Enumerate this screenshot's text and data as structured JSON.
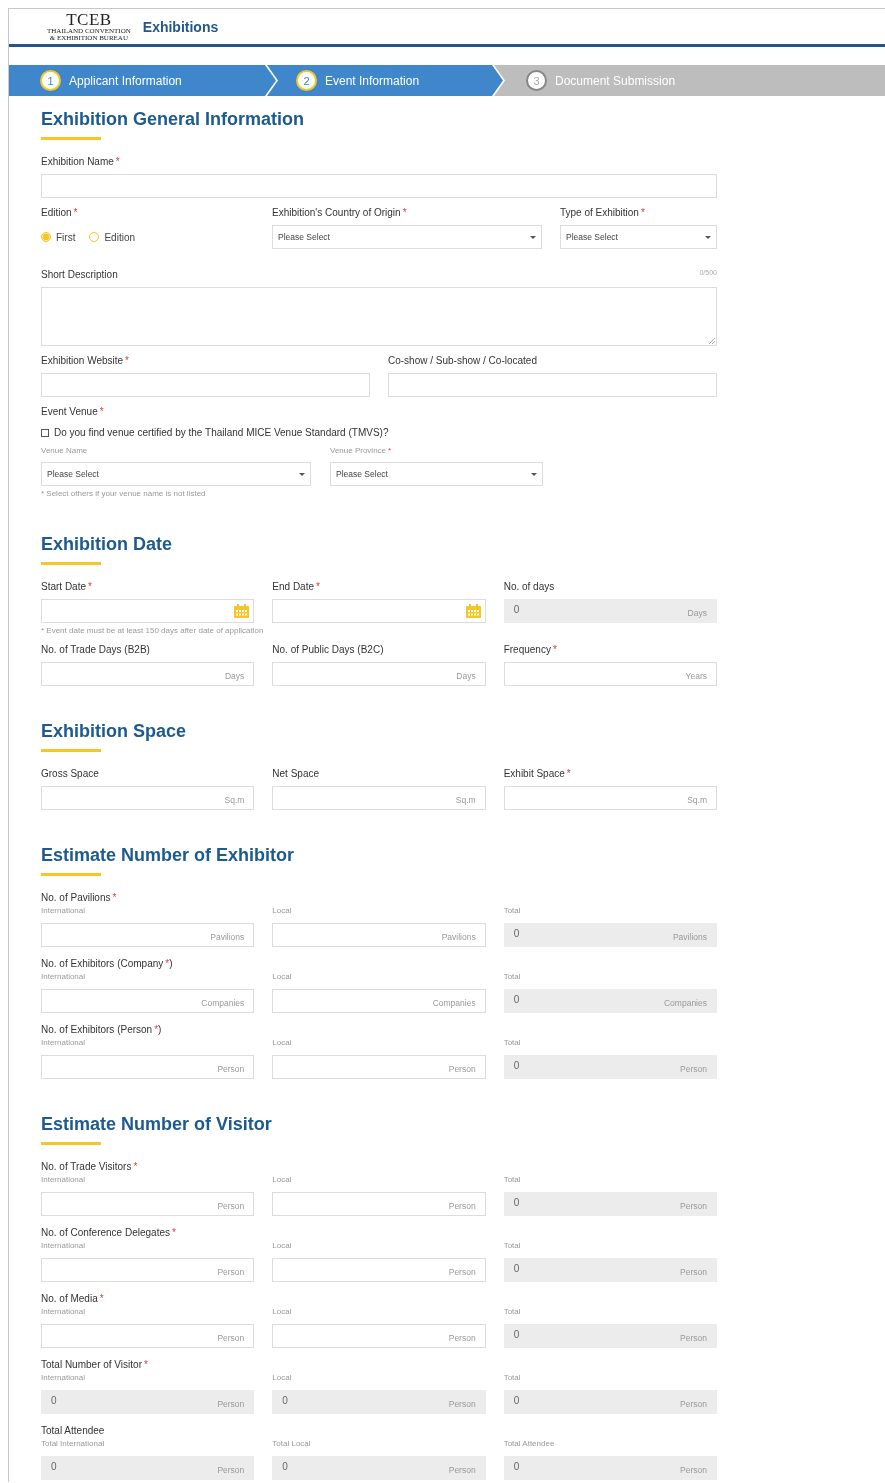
{
  "header": {
    "logo": {
      "wordmark": "TCEB",
      "line_1": "THAILAND CONVENTION",
      "line_2": "& EXHIBITION BUREAU"
    },
    "title": "Exhibitions"
  },
  "steps": [
    {
      "number": "1",
      "label": "Applicant Information",
      "active": true
    },
    {
      "number": "2",
      "label": "Event Information",
      "active": true
    },
    {
      "number": "3",
      "label": "Document Submission",
      "active": false
    }
  ],
  "sections": [
    {
      "title": "Exhibition General Information",
      "rows": [
        {
          "kind": "single",
          "fields": [
            {
              "kind": "text",
              "label": "Exhibition Name",
              "required_mark": "*"
            }
          ]
        },
        {
          "kind": "choice",
          "fields": [
            {
              "kind": "radio",
              "label": "Edition",
              "required_mark": "*",
              "options": [
                {
                  "label": "First",
                  "selected": true
                },
                {
                  "label": "Edition",
                  "selected": false
                }
              ]
            },
            {
              "kind": "select",
              "label": "Exhibition's Country of Origin",
              "required_mark": "*",
              "value": "Please Select"
            },
            {
              "kind": "select",
              "label": "Type of Exhibition",
              "required_mark": "*",
              "value": "Please Select"
            }
          ]
        },
        {
          "kind": "single",
          "fields": [
            {
              "kind": "textarea",
              "label": "Short Description",
              "counter": "0/500"
            }
          ]
        },
        {
          "kind": "pair",
          "fields": [
            {
              "kind": "text",
              "label": "Exhibition Website",
              "required_mark": "*"
            },
            {
              "kind": "text",
              "label": "Co-show / Sub-show / Co-located"
            }
          ]
        },
        {
          "kind": "venue",
          "label": "Event Venue",
          "required_mark": "*",
          "checkbox": {
            "label": "Do you find venue certified by the Thailand MICE Venue Standard (TMVS)?",
            "checked": false
          },
          "fields": [
            {
              "kind": "select",
              "sublabel": "Venue Name",
              "value": "Please Select"
            },
            {
              "kind": "select",
              "sublabel": "Venue Province",
              "required_mark": "*",
              "value": "Please Select"
            }
          ],
          "note": "* Select others if your venue name is not listed"
        }
      ]
    },
    {
      "title": "Exhibition Date",
      "rows": [
        {
          "kind": "triple",
          "fields": [
            {
              "kind": "date",
              "label": "Start Date",
              "required_mark": "*"
            },
            {
              "kind": "date",
              "label": "End Date",
              "required_mark": "*"
            },
            {
              "kind": "unit",
              "label": "No. of days",
              "readonly": true,
              "value": "0",
              "unit": "Days"
            }
          ]
        },
        {
          "kind": "note",
          "note": "* Event date must be at least 150 days after date of application"
        },
        {
          "kind": "triple",
          "fields": [
            {
              "kind": "unit",
              "label": "No. of Trade Days (B2B)",
              "unit": "Days",
              "readonly": false
            },
            {
              "kind": "unit",
              "label": "No. of Public Days (B2C)",
              "unit": "Days",
              "readonly": false
            },
            {
              "kind": "unit",
              "label": "Frequency",
              "required_mark": "*",
              "unit": "Years",
              "readonly": false
            }
          ]
        }
      ]
    },
    {
      "title": "Exhibition Space",
      "rows": [
        {
          "kind": "triple",
          "fields": [
            {
              "kind": "unit",
              "label": "Gross Space",
              "unit": "Sq.m",
              "readonly": false
            },
            {
              "kind": "unit",
              "label": "Net Space",
              "unit": "Sq.m",
              "readonly": false
            },
            {
              "kind": "unit",
              "label": "Exhibit Space",
              "required_mark": "*",
              "unit": "Sq.m",
              "readonly": false
            }
          ]
        }
      ]
    },
    {
      "title": "Estimate Number of Exhibitor",
      "rows": [
        {
          "kind": "group",
          "label": "No. of Pavilions",
          "required_mark": "*",
          "fields": [
            {
              "kind": "unit",
              "sublabel": "International",
              "unit": "Pavilions",
              "readonly": false
            },
            {
              "kind": "unit",
              "sublabel": "Local",
              "unit": "Pavilions",
              "readonly": false
            },
            {
              "kind": "unit",
              "sublabel": "Total",
              "unit": "Pavilions",
              "readonly": true,
              "value": "0"
            }
          ]
        },
        {
          "kind": "group",
          "label": "No. of Exhibitors (Company",
          "required_mark": "*",
          "label_end": ")",
          "fields": [
            {
              "kind": "unit",
              "sublabel": "International",
              "unit": "Companies",
              "readonly": false
            },
            {
              "kind": "unit",
              "sublabel": "Local",
              "unit": "Companies",
              "readonly": false
            },
            {
              "kind": "unit",
              "sublabel": "Total",
              "unit": "Companies",
              "readonly": true,
              "value": "0"
            }
          ]
        },
        {
          "kind": "group",
          "label": "No. of Exhibitors (Person",
          "required_mark": "*",
          "label_end": ")",
          "fields": [
            {
              "kind": "unit",
              "sublabel": "International",
              "unit": "Person",
              "readonly": false
            },
            {
              "kind": "unit",
              "sublabel": "Local",
              "unit": "Person",
              "readonly": false
            },
            {
              "kind": "unit",
              "sublabel": "Total",
              "unit": "Person",
              "readonly": true,
              "value": "0"
            }
          ]
        }
      ]
    },
    {
      "title": "Estimate Number of Visitor",
      "rows": [
        {
          "kind": "group",
          "label": "No. of Trade Visitors",
          "required_mark": "*",
          "fields": [
            {
              "kind": "unit",
              "sublabel": "International",
              "unit": "Person",
              "readonly": false
            },
            {
              "kind": "unit",
              "sublabel": "Local",
              "unit": "Person",
              "readonly": false
            },
            {
              "kind": "unit",
              "sublabel": "Total",
              "unit": "Person",
              "readonly": true,
              "value": "0"
            }
          ]
        },
        {
          "kind": "group",
          "label": "No. of Conference Delegates",
          "required_mark": "*",
          "fields": [
            {
              "kind": "unit",
              "sublabel": "International",
              "unit": "Person",
              "readonly": false
            },
            {
              "kind": "unit",
              "sublabel": "Local",
              "unit": "Person",
              "readonly": false
            },
            {
              "kind": "unit",
              "sublabel": "Total",
              "unit": "Person",
              "readonly": true,
              "value": "0"
            }
          ]
        },
        {
          "kind": "group",
          "label": "No. of Media",
          "required_mark": "*",
          "fields": [
            {
              "kind": "unit",
              "sublabel": "International",
              "unit": "Person",
              "readonly": false
            },
            {
              "kind": "unit",
              "sublabel": "Local",
              "unit": "Person",
              "readonly": false
            },
            {
              "kind": "unit",
              "sublabel": "Total",
              "unit": "Person",
              "readonly": true,
              "value": "0"
            }
          ]
        },
        {
          "kind": "group",
          "label": "Total Number of Visitor",
          "required_mark": "*",
          "fields": [
            {
              "kind": "unit",
              "sublabel": "International",
              "unit": "Person",
              "readonly": true,
              "value": "0"
            },
            {
              "kind": "unit",
              "sublabel": "Local",
              "unit": "Person",
              "readonly": true,
              "value": "0"
            },
            {
              "kind": "unit",
              "sublabel": "Total",
              "unit": "Person",
              "readonly": true,
              "value": "0"
            }
          ]
        },
        {
          "kind": "group",
          "label": "Total Attendee",
          "fields": [
            {
              "kind": "unit",
              "sublabel": "Total International",
              "unit": "Person",
              "readonly": true,
              "value": "0"
            },
            {
              "kind": "unit",
              "sublabel": "Total Local",
              "unit": "Person",
              "readonly": true,
              "value": "0"
            },
            {
              "kind": "unit",
              "sublabel": "Total Attendee",
              "unit": "Person",
              "readonly": true,
              "value": "0"
            }
          ]
        }
      ]
    }
  ]
}
